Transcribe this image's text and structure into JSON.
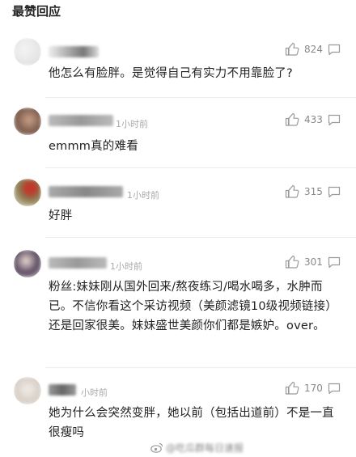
{
  "section": {
    "title": "最赞回应"
  },
  "comments": [
    {
      "likes": "824",
      "time": "",
      "text": "他怎么有脸胖。是觉得自己有实力不用靠脸了?"
    },
    {
      "likes": "433",
      "time": "1小时前",
      "text": "emmm真的难看"
    },
    {
      "likes": "315",
      "time": "1小时前",
      "text": "好胖"
    },
    {
      "likes": "301",
      "time": "1小时前",
      "text": "粉丝:妹妹刚从国外回来/熬夜练习/喝水喝多，水肿而已。不信你看这个采访视频（美颜滤镜10级视频链接）还是回家很美。妹妹盛世美颜你们都是嫉妒。over。"
    },
    {
      "likes": "170",
      "time": "小时前",
      "text": "她为什么会突然变胖，她以前（包括出道前）不是一直很瘦吗"
    }
  ],
  "watermark": {
    "text": "@吃瓜群每日速报"
  }
}
